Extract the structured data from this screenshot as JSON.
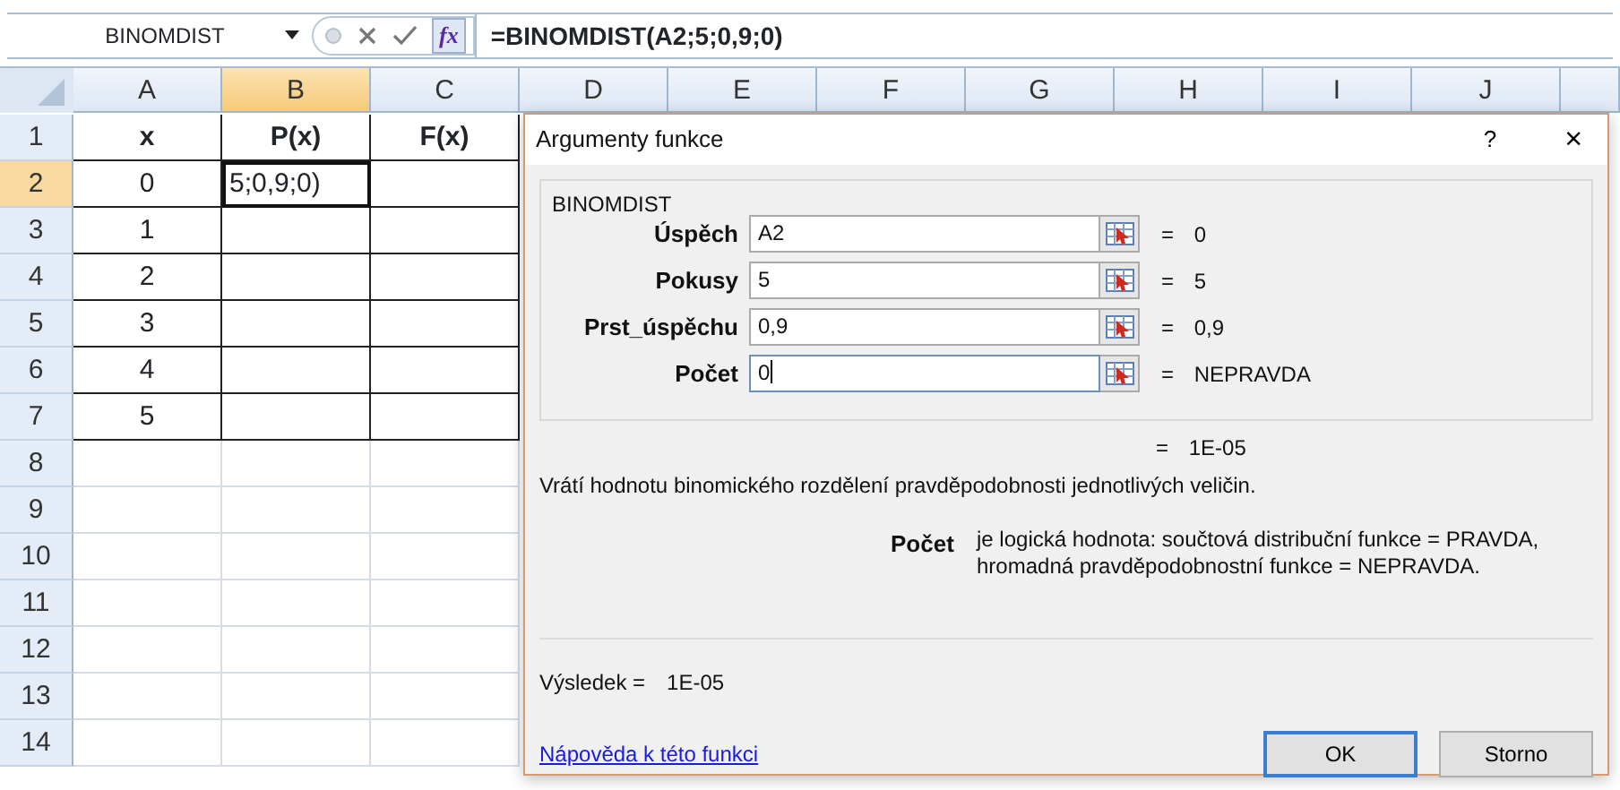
{
  "formula_bar": {
    "name_box": "BINOMDIST",
    "function_button": "fx",
    "formula": "=BINOMDIST(A2;5;0,9;0)"
  },
  "sheet": {
    "columns": [
      {
        "label": "A",
        "selected": false
      },
      {
        "label": "B",
        "selected": true
      },
      {
        "label": "C",
        "selected": false
      },
      {
        "label": "D",
        "selected": false
      },
      {
        "label": "E",
        "selected": false
      },
      {
        "label": "F",
        "selected": false
      },
      {
        "label": "G",
        "selected": false
      },
      {
        "label": "H",
        "selected": false
      },
      {
        "label": "I",
        "selected": false
      },
      {
        "label": "J",
        "selected": false
      }
    ],
    "rows": [
      {
        "label": "1",
        "selected": false,
        "kind": "header",
        "cells": [
          {
            "text": "x",
            "selected": false
          },
          {
            "text": "P(x)",
            "selected": false
          },
          {
            "text": "F(x)",
            "selected": false
          }
        ]
      },
      {
        "label": "2",
        "selected": true,
        "kind": "table",
        "cells": [
          {
            "text": "0",
            "selected": false
          },
          {
            "text": "5;0,9;0)",
            "selected": true
          },
          {
            "selected": false
          }
        ]
      },
      {
        "label": "3",
        "selected": false,
        "kind": "table",
        "cells": [
          {
            "text": "1",
            "selected": false
          },
          {
            "selected": false
          },
          {
            "selected": false
          }
        ]
      },
      {
        "label": "4",
        "selected": false,
        "kind": "table",
        "cells": [
          {
            "text": "2",
            "selected": false
          },
          {
            "selected": false
          },
          {
            "selected": false
          }
        ]
      },
      {
        "label": "5",
        "selected": false,
        "kind": "table",
        "cells": [
          {
            "text": "3",
            "selected": false
          },
          {
            "selected": false
          },
          {
            "selected": false
          }
        ]
      },
      {
        "label": "6",
        "selected": false,
        "kind": "table",
        "cells": [
          {
            "text": "4",
            "selected": false
          },
          {
            "selected": false
          },
          {
            "selected": false
          }
        ]
      },
      {
        "label": "7",
        "selected": false,
        "kind": "table",
        "cells": [
          {
            "text": "5",
            "selected": false
          },
          {
            "selected": false
          },
          {
            "selected": false
          }
        ]
      },
      {
        "label": "8",
        "selected": false,
        "kind": "blank",
        "cells": []
      },
      {
        "label": "9",
        "selected": false,
        "kind": "blank",
        "cells": []
      },
      {
        "label": "10",
        "selected": false,
        "kind": "blank",
        "cells": []
      },
      {
        "label": "11",
        "selected": false,
        "kind": "blank",
        "cells": []
      },
      {
        "label": "12",
        "selected": false,
        "kind": "blank",
        "cells": []
      },
      {
        "label": "13",
        "selected": false,
        "kind": "blank",
        "cells": []
      },
      {
        "label": "14",
        "selected": false,
        "kind": "blank",
        "cells": []
      }
    ]
  },
  "dialog": {
    "title": "Argumenty funkce",
    "help_button": "?",
    "close_button": "×",
    "group": "BINOMDIST",
    "arguments": [
      {
        "label": "Úspěch",
        "value": "A2",
        "result": "= 0",
        "focused": false
      },
      {
        "label": "Pokusy",
        "value": "5",
        "result": "= 5",
        "focused": false
      },
      {
        "label": "Prst_úspěchu",
        "value": "0,9",
        "result": "= 0,9",
        "focused": false
      },
      {
        "label": "Počet",
        "value": "0",
        "result": "= NEPRAVDA",
        "focused": true
      }
    ],
    "formula_result": "= 1E-05",
    "description": "Vrátí hodnotu binomického rozdělení pravděpodobnosti jednotlivých veličin.",
    "argument_name": "Počet",
    "argument_help": [
      "je logická hodnota: součtová distribuční funkce = PRAVDA,",
      "hromadná pravděpodobnostní funkce = NEPRAVDA."
    ],
    "result_label": "Výsledek =",
    "result_value": "1E-05",
    "help_link": "Nápověda k této funkci",
    "buttons": [
      {
        "label": "OK",
        "default": true
      },
      {
        "label": "Storno",
        "default": false
      }
    ]
  }
}
